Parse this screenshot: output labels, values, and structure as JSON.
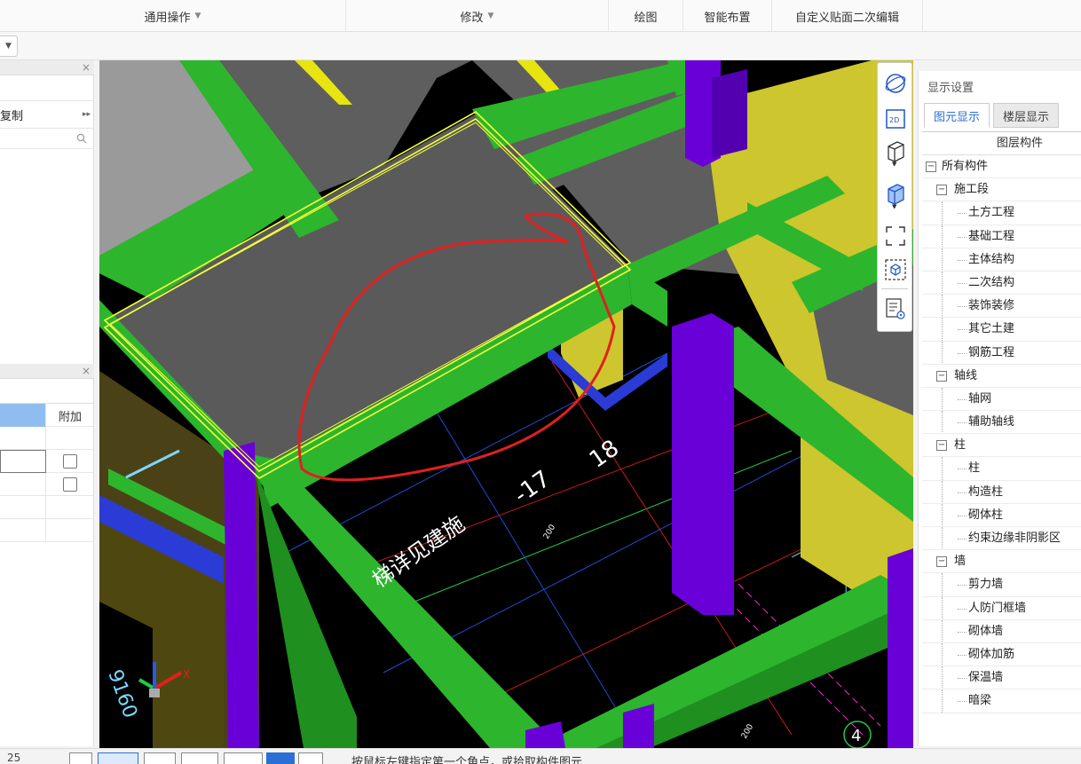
{
  "ribbon": {
    "general_ops": "通用操作",
    "modify": "修改",
    "draw": "绘图",
    "smart_layout": "智能布置",
    "custom_edit": "自定义贴面二次编辑"
  },
  "left_panel": {
    "copy_label": "复制",
    "attach_header": "附加"
  },
  "viewport": {
    "axis_label_17": "-17",
    "axis_label_18": "18",
    "note_text": "梯详见建施",
    "grid_number": "4",
    "coord_text": "9160",
    "small_label": "200"
  },
  "right_panel": {
    "title": "显示设置",
    "tabs": [
      "图元显示",
      "楼层显示"
    ],
    "tree_header": "图层构件",
    "tree": [
      {
        "label": "所有构件",
        "level": 0,
        "toggle": "−"
      },
      {
        "label": "施工段",
        "level": 1,
        "toggle": "−"
      },
      {
        "label": "土方工程",
        "level": 2
      },
      {
        "label": "基础工程",
        "level": 2
      },
      {
        "label": "主体结构",
        "level": 2
      },
      {
        "label": "二次结构",
        "level": 2
      },
      {
        "label": "装饰装修",
        "level": 2
      },
      {
        "label": "其它土建",
        "level": 2
      },
      {
        "label": "钢筋工程",
        "level": 2
      },
      {
        "label": "轴线",
        "level": 1,
        "toggle": "−"
      },
      {
        "label": "轴网",
        "level": 2
      },
      {
        "label": "辅助轴线",
        "level": 2
      },
      {
        "label": "柱",
        "level": 1,
        "toggle": "−"
      },
      {
        "label": "柱",
        "level": 2
      },
      {
        "label": "构造柱",
        "level": 2
      },
      {
        "label": "砌体柱",
        "level": 2
      },
      {
        "label": "约束边缘非阴影区",
        "level": 2
      },
      {
        "label": "墙",
        "level": 1,
        "toggle": "−"
      },
      {
        "label": "剪力墙",
        "level": 2
      },
      {
        "label": "人防门框墙",
        "level": 2
      },
      {
        "label": "砌体墙",
        "level": 2
      },
      {
        "label": "砌体加筋",
        "level": 2
      },
      {
        "label": "保温墙",
        "level": 2
      },
      {
        "label": "暗梁",
        "level": 2
      }
    ]
  },
  "status_bar": {
    "coord_value": "25",
    "prompt": "按鼠标左键指定第一个角点，或拾取构件图元"
  },
  "colors": {
    "beam_green": "#2db52d",
    "column_purple": "#6a00d8",
    "wall_yellow": "#cdc62e",
    "slab_gray": "#5e5e5e",
    "annotation_red": "#e0201f",
    "selection_yellow": "#f5ff3c"
  }
}
